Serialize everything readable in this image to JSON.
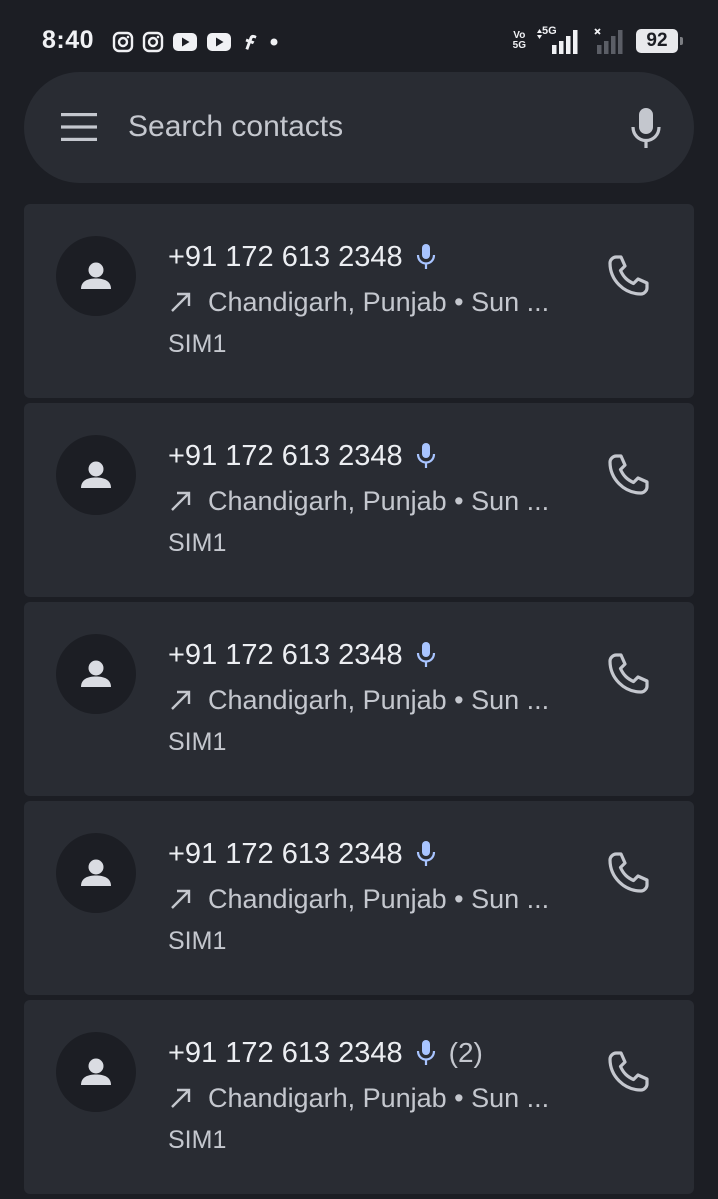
{
  "status_bar": {
    "time": "8:40",
    "notifications": [
      "instagram-icon",
      "instagram-icon",
      "youtube-icon",
      "youtube-icon",
      "facebook-icon",
      "dot-icon"
    ],
    "volte_top": "Vo",
    "volte_bottom": "5G",
    "network": "5G",
    "battery": "92"
  },
  "search": {
    "placeholder": "Search contacts"
  },
  "calls": [
    {
      "number": "+91 172 613 2348",
      "count": "",
      "location": "Chandigarh, Punjab • Sun ...",
      "sim": "SIM1"
    },
    {
      "number": "+91 172 613 2348",
      "count": "",
      "location": "Chandigarh, Punjab • Sun ...",
      "sim": "SIM1"
    },
    {
      "number": "+91 172 613 2348",
      "count": "",
      "location": "Chandigarh, Punjab • Sun ...",
      "sim": "SIM1"
    },
    {
      "number": "+91 172 613 2348",
      "count": "",
      "location": "Chandigarh, Punjab • Sun ...",
      "sim": "SIM1"
    },
    {
      "number": "+91 172 613 2348",
      "count": "(2)",
      "location": "Chandigarh, Punjab • Sun ...",
      "sim": "SIM1"
    }
  ],
  "colors": {
    "background": "#1c1e24",
    "card": "#292c33",
    "voicemail_accent": "#a8c4ff",
    "text_primary": "#eceef2",
    "text_secondary": "#c4c7ce"
  }
}
